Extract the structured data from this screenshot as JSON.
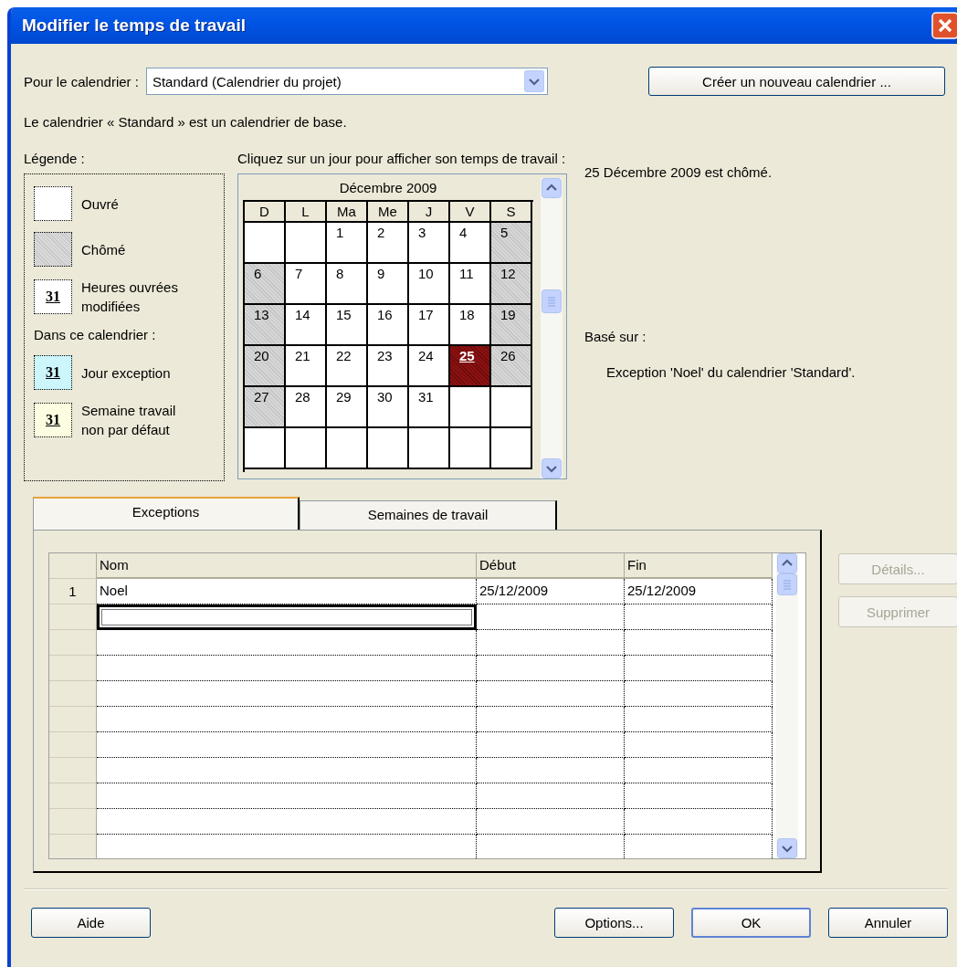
{
  "window": {
    "title": "Modifier le temps de travail"
  },
  "calendar_select": {
    "label": "Pour le calendrier :",
    "value": "Standard (Calendrier du projet)"
  },
  "new_calendar_button": "Créer un nouveau calendrier ...",
  "base_note": "Le calendrier « Standard » est un calendrier de base.",
  "legend": {
    "title": "Légende :",
    "items": [
      {
        "kind": "working",
        "label": "Ouvré"
      },
      {
        "kind": "nonworking",
        "label": "Chômé"
      },
      {
        "kind": "modified",
        "number": "31",
        "label": "Heures ouvrées modifiées"
      }
    ],
    "section": "Dans ce calendrier :",
    "calendar_items": [
      {
        "kind": "exception",
        "number": "31",
        "label": "Jour exception"
      },
      {
        "kind": "nondefault",
        "number": "31",
        "label": "Semaine travail non par défaut"
      }
    ]
  },
  "calendar": {
    "prompt": "Cliquez sur un jour pour afficher son temps de travail :",
    "month": "Décembre 2009",
    "weekdays": [
      "D",
      "L",
      "Ma",
      "Me",
      "J",
      "V",
      "S"
    ],
    "weeks": [
      [
        {
          "kind": "empty",
          "selected": false
        },
        {
          "kind": "empty",
          "selected": false
        },
        {
          "day": "1",
          "kind": "working",
          "selected": false
        },
        {
          "day": "2",
          "kind": "working",
          "selected": false
        },
        {
          "day": "3",
          "kind": "working",
          "selected": false
        },
        {
          "day": "4",
          "kind": "working",
          "selected": false
        },
        {
          "day": "5",
          "kind": "nonworking",
          "selected": false
        }
      ],
      [
        {
          "day": "6",
          "kind": "nonworking",
          "selected": false
        },
        {
          "day": "7",
          "kind": "working",
          "selected": false
        },
        {
          "day": "8",
          "kind": "working",
          "selected": false
        },
        {
          "day": "9",
          "kind": "working",
          "selected": false
        },
        {
          "day": "10",
          "kind": "working",
          "selected": false
        },
        {
          "day": "11",
          "kind": "working",
          "selected": false
        },
        {
          "day": "12",
          "kind": "nonworking",
          "selected": false
        }
      ],
      [
        {
          "day": "13",
          "kind": "nonworking",
          "selected": false
        },
        {
          "day": "14",
          "kind": "working",
          "selected": false
        },
        {
          "day": "15",
          "kind": "working",
          "selected": false
        },
        {
          "day": "16",
          "kind": "working",
          "selected": false
        },
        {
          "day": "17",
          "kind": "working",
          "selected": false
        },
        {
          "day": "18",
          "kind": "working",
          "selected": false
        },
        {
          "day": "19",
          "kind": "nonworking",
          "selected": false
        }
      ],
      [
        {
          "day": "20",
          "kind": "nonworking",
          "selected": false
        },
        {
          "day": "21",
          "kind": "working",
          "selected": false
        },
        {
          "day": "22",
          "kind": "working",
          "selected": false
        },
        {
          "day": "23",
          "kind": "working",
          "selected": false
        },
        {
          "day": "24",
          "kind": "working",
          "selected": false
        },
        {
          "day": "25",
          "kind": "exception",
          "selected": true
        },
        {
          "day": "26",
          "kind": "nonworking",
          "selected": false
        }
      ],
      [
        {
          "day": "27",
          "kind": "nonworking",
          "selected": false
        },
        {
          "day": "28",
          "kind": "working",
          "selected": false
        },
        {
          "day": "29",
          "kind": "working",
          "selected": false
        },
        {
          "day": "30",
          "kind": "working",
          "selected": false
        },
        {
          "day": "31",
          "kind": "working",
          "selected": false
        },
        {
          "kind": "empty",
          "selected": false
        },
        {
          "kind": "empty",
          "selected": false
        }
      ],
      [
        {
          "kind": "empty",
          "selected": false
        },
        {
          "kind": "empty",
          "selected": false
        },
        {
          "kind": "empty",
          "selected": false
        },
        {
          "kind": "empty",
          "selected": false
        },
        {
          "kind": "empty",
          "selected": false
        },
        {
          "kind": "empty",
          "selected": false
        },
        {
          "kind": "empty",
          "selected": false
        }
      ]
    ]
  },
  "day_info": {
    "status": "25 Décembre 2009 est chômé.",
    "based_on_label": "Basé sur :",
    "based_on": "Exception 'Noel' du calendrier 'Standard'."
  },
  "tabs": [
    {
      "label": "Exceptions",
      "selected": true
    },
    {
      "label": "Semaines de travail",
      "selected": false
    }
  ],
  "table": {
    "columns": [
      "Nom",
      "Début",
      "Fin"
    ],
    "rows": [
      {
        "number": "1",
        "cells": [
          "Noel",
          "25/12/2009",
          "25/12/2009"
        ],
        "focused": false
      },
      {
        "focused": true
      },
      {
        "focused": false
      },
      {
        "focused": false
      },
      {
        "focused": false
      },
      {
        "focused": false
      },
      {
        "focused": false
      },
      {
        "focused": false
      },
      {
        "focused": false
      },
      {
        "focused": false
      },
      {
        "focused": false
      }
    ]
  },
  "side_buttons": [
    {
      "label": "Détails...",
      "disabled": true
    },
    {
      "label": "Supprimer",
      "disabled": true
    }
  ],
  "footer_buttons": [
    {
      "label": "Aide",
      "default": false
    },
    {
      "label": "Options...",
      "default": false
    },
    {
      "label": "OK",
      "default": true
    },
    {
      "label": "Annuler",
      "default": false
    }
  ]
}
